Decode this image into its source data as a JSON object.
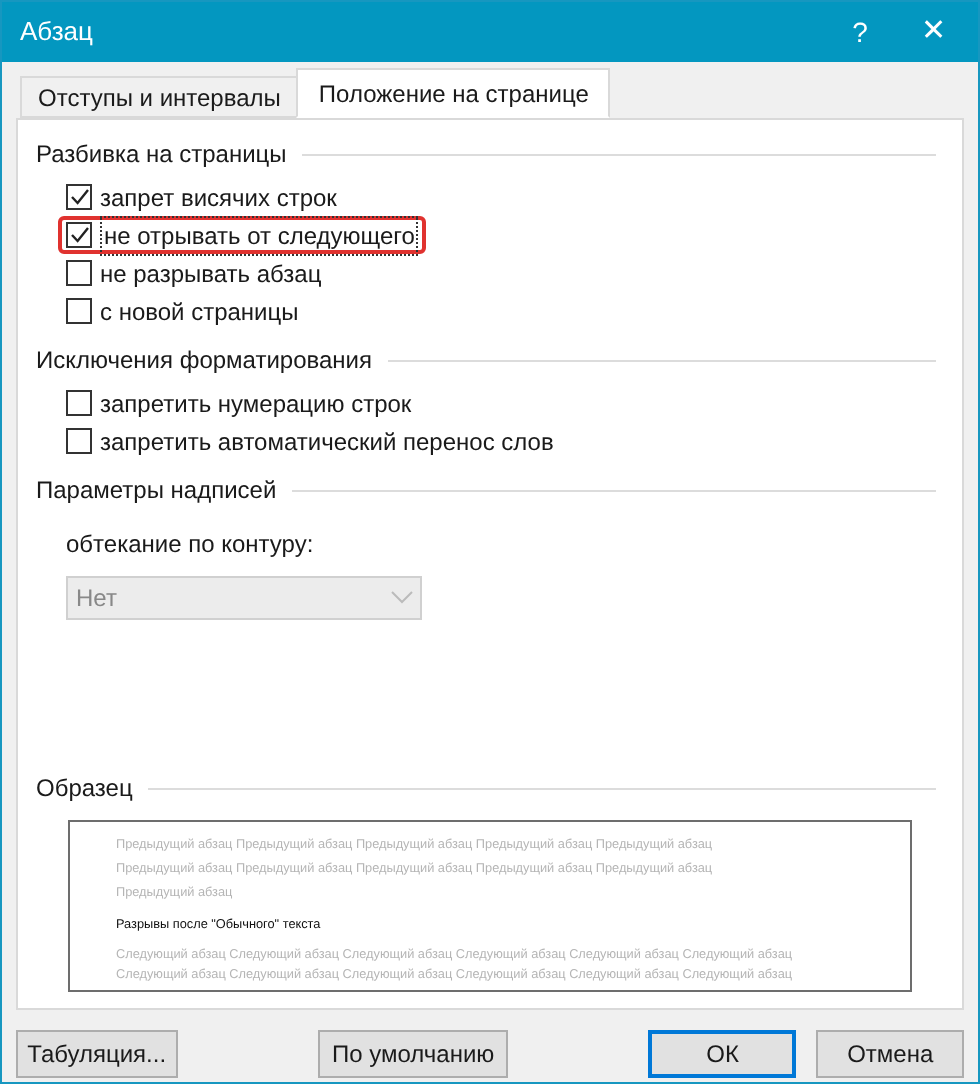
{
  "window": {
    "title": "Абзац",
    "help": "?",
    "close": "✕"
  },
  "tabs": [
    {
      "label": "Отступы и интервалы",
      "selected": false
    },
    {
      "label": "Положение на странице",
      "selected": true
    }
  ],
  "sections": [
    {
      "title": "Разбивка на страницы",
      "checkboxes": [
        {
          "label": "запрет висячих строк",
          "checked": true,
          "highlighted": false
        },
        {
          "label": "не отрывать от следующего",
          "checked": true,
          "highlighted": true
        },
        {
          "label": "не разрывать абзац",
          "checked": false,
          "highlighted": false
        },
        {
          "label": "с новой страницы",
          "checked": false,
          "highlighted": false
        }
      ]
    },
    {
      "title": "Исключения форматирования",
      "checkboxes": [
        {
          "label": "запретить нумерацию строк",
          "checked": false,
          "highlighted": false
        },
        {
          "label": "запретить автоматический перенос слов",
          "checked": false,
          "highlighted": false
        }
      ]
    }
  ],
  "textbox_options": {
    "title": "Параметры надписей",
    "field_label": "обтекание по контуру:",
    "value": "Нет",
    "disabled": true
  },
  "preview": {
    "title": "Образец",
    "previous_lines": [
      "Предыдущий абзац Предыдущий абзац Предыдущий абзац Предыдущий абзац Предыдущий абзац",
      "Предыдущий абзац Предыдущий абзац Предыдущий абзац Предыдущий абзац Предыдущий абзац",
      "Предыдущий абзац"
    ],
    "current": "Разрывы после \"Обычного\" текста",
    "next_lines": [
      "Следующий абзац Следующий абзац Следующий абзац Следующий абзац Следующий абзац Следующий абзац",
      "Следующий абзац Следующий абзац Следующий абзац Следующий абзац Следующий абзац Следующий абзац"
    ]
  },
  "buttons": [
    {
      "label": "Табуляция...",
      "default": false
    },
    {
      "label": "По умолчанию",
      "default": false
    },
    {
      "label": "ОК",
      "default": true
    },
    {
      "label": "Отмена",
      "default": false
    }
  ]
}
